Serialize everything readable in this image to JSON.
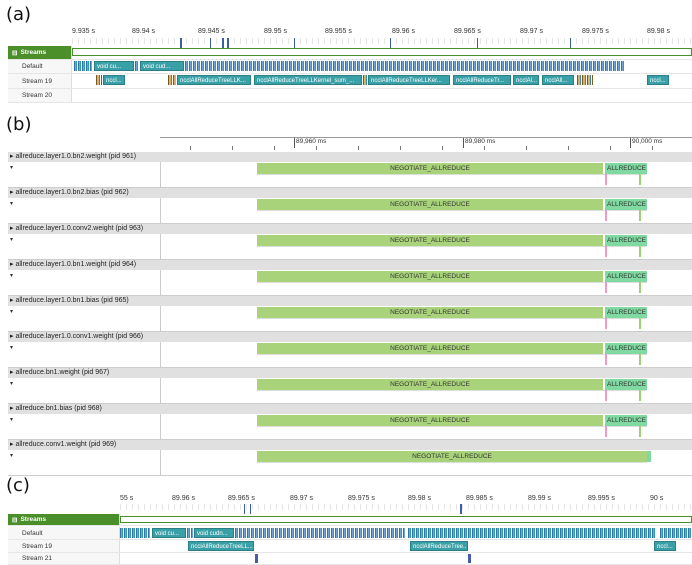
{
  "panels": {
    "a": "(a)",
    "b": "(b)",
    "c": "(c)"
  },
  "panel_a": {
    "ticks": [
      "9.935 s",
      "89.94 s",
      "89.945 s",
      "89.95 s",
      "89.955 s",
      "89.96 s",
      "89.965 s",
      "89.97 s",
      "89.975 s",
      "89.98 s"
    ],
    "rows": {
      "streams": "Streams",
      "default": "Default",
      "stream19": "Stream 19",
      "stream20": "Stream 20"
    },
    "default_kernels": [
      "void cu...",
      "void cud..."
    ],
    "stream19_kernels": [
      "nccl...",
      "ncclAllReduceTreeLLK...",
      "ncclAllReduceTreeLLKernel_sum_...",
      "ncclAllReduceTreeLLKer...",
      "ncclAllReduceTr...",
      "ncclAl...",
      "ncclAll...",
      "nccl..."
    ]
  },
  "panel_b": {
    "ticks": [
      "89,960 ms",
      "89,980 ms",
      "90,000 ms"
    ],
    "processes": [
      {
        "name": "allreduce.layer1.0.bn2.weight (pid 961)",
        "neg": "NEGOTIATE_ALLREDUCE",
        "all": "ALLREDUCE"
      },
      {
        "name": "allreduce.layer1.0.bn2.bias (pid 962)",
        "neg": "NEGOTIATE_ALLREDUCE",
        "all": "ALLREDUCE"
      },
      {
        "name": "allreduce.layer1.0.conv2.weight (pid 963)",
        "neg": "NEGOTIATE_ALLREDUCE",
        "all": "ALLREDUCE"
      },
      {
        "name": "allreduce.layer1.0.bn1.weight (pid 964)",
        "neg": "NEGOTIATE_ALLREDUCE",
        "all": "ALLREDUCE"
      },
      {
        "name": "allreduce.layer1.0.bn1.bias (pid 965)",
        "neg": "NEGOTIATE_ALLREDUCE",
        "all": "ALLREDUCE"
      },
      {
        "name": "allreduce.layer1.0.conv1.weight (pid 966)",
        "neg": "NEGOTIATE_ALLREDUCE",
        "all": "ALLREDUCE"
      },
      {
        "name": "allreduce.bn1.weight (pid 967)",
        "neg": "NEGOTIATE_ALLREDUCE",
        "all": "ALLREDUCE"
      },
      {
        "name": "allreduce.bn1.bias (pid 968)",
        "neg": "NEGOTIATE_ALLREDUCE",
        "all": "ALLREDUCE"
      },
      {
        "name": "allreduce.conv1.weight (pid 969)",
        "neg": "NEGOTIATE_ALLREDUCE",
        "all": ""
      }
    ]
  },
  "panel_c": {
    "ticks": [
      "55 s",
      "89.96 s",
      "89.965 s",
      "89.97 s",
      "89.975 s",
      "89.98 s",
      "89.985 s",
      "89.99 s",
      "89.995 s",
      "90 s"
    ],
    "rows": {
      "streams": "Streams",
      "default": "Default",
      "stream19": "Stream 19",
      "stream21": "Stream 21"
    },
    "default_kernels": [
      "void cu...",
      "void cudn..."
    ],
    "stream19_kernels": [
      "ncclAllReduceTreeLL...",
      "ncclAllReduceTree...",
      "nccl..."
    ]
  }
}
